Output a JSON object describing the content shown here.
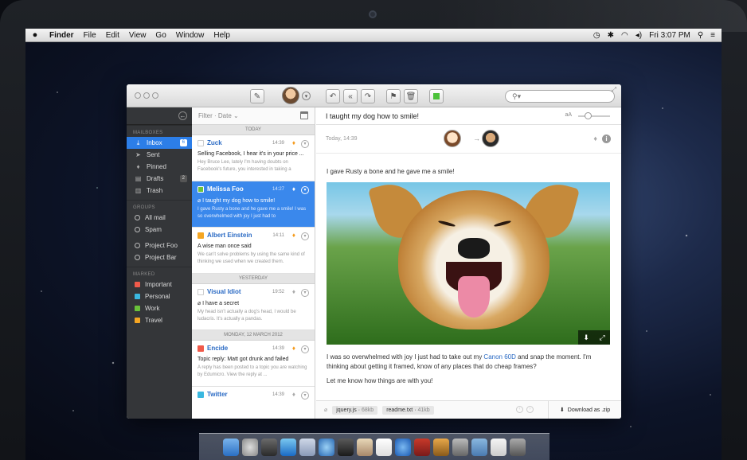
{
  "menubar": {
    "apple": "",
    "items": [
      "Finder",
      "File",
      "Edit",
      "View",
      "Go",
      "Window",
      "Help"
    ],
    "clock": "Fri 3:07 PM"
  },
  "toolbar": {
    "search_placeholder": ""
  },
  "sidebar": {
    "sections": [
      {
        "title": "Mailboxes",
        "items": [
          {
            "label": "Inbox",
            "badge": "6",
            "active": true
          },
          {
            "label": "Sent"
          },
          {
            "label": "Pinned"
          },
          {
            "label": "Drafts",
            "badge": "2"
          },
          {
            "label": "Trash"
          }
        ]
      },
      {
        "title": "Groups",
        "items": [
          {
            "label": "All mail"
          },
          {
            "label": "Spam"
          },
          {
            "label": "Project Foo"
          },
          {
            "label": "Project Bar"
          }
        ]
      },
      {
        "title": "Marked",
        "items": [
          {
            "label": "Important",
            "color": "#f05a4a"
          },
          {
            "label": "Personal",
            "color": "#3ab8e0"
          },
          {
            "label": "Work",
            "color": "#6ac23a"
          },
          {
            "label": "Travel",
            "color": "#f5a623"
          }
        ]
      }
    ]
  },
  "list": {
    "filter": "Filter · Date",
    "today": "Today",
    "yesterday": "Yesterday",
    "march": "Monday, 12 March 2012",
    "messages": [
      {
        "from": "Zuck",
        "time": "14:39",
        "subject": "Selling Facebook, I hear it's in your price ...",
        "preview": "Hey Bruce Lee, lately I'm having doubts on Facebook's future, you interested in taking a"
      },
      {
        "from": "Melissa Foo",
        "time": "14:27",
        "subject": "I taught my dog how to smile!",
        "preview": "I gave Rusty a bone and he gave me a smile! I was so overwhelmed with joy I just had to"
      },
      {
        "from": "Albert Einstein",
        "time": "14:11",
        "subject": "A wise man once said",
        "preview": "We can't solve problems by using the same kind of thinking we used when we created them."
      },
      {
        "from": "Visual Idiot",
        "time": "19:52",
        "subject": "I have a secret",
        "preview": "My head isn't actually a dog's head, I would be ludacris. It's actually a pandas."
      },
      {
        "from": "Encide",
        "time": "14:39",
        "subject": "Topic reply: Matt got drunk and failed",
        "preview": "A reply has been posted to a topic you are watching by Edumicro. View the reply at ..."
      },
      {
        "from": "Twitter",
        "time": "14:39"
      }
    ]
  },
  "reader": {
    "subject": "I taught my dog how to smile!",
    "text_size": "aA",
    "date": "Today, 14:39",
    "line1": "I gave Rusty a bone and he gave me a smile!",
    "line2a": "I was so overwhelmed with joy I just had to take out my ",
    "camera": "Canon 60D",
    "line2b": " and snap the moment. I'm thinking about getting it framed, know of any places that do cheap frames?",
    "line3": "Let me know how things are with you!",
    "attachments": [
      {
        "name": "jquery.js",
        "size": "68kb"
      },
      {
        "name": "readme.txt",
        "size": "41kb"
      }
    ],
    "download": "Download as .zip"
  }
}
